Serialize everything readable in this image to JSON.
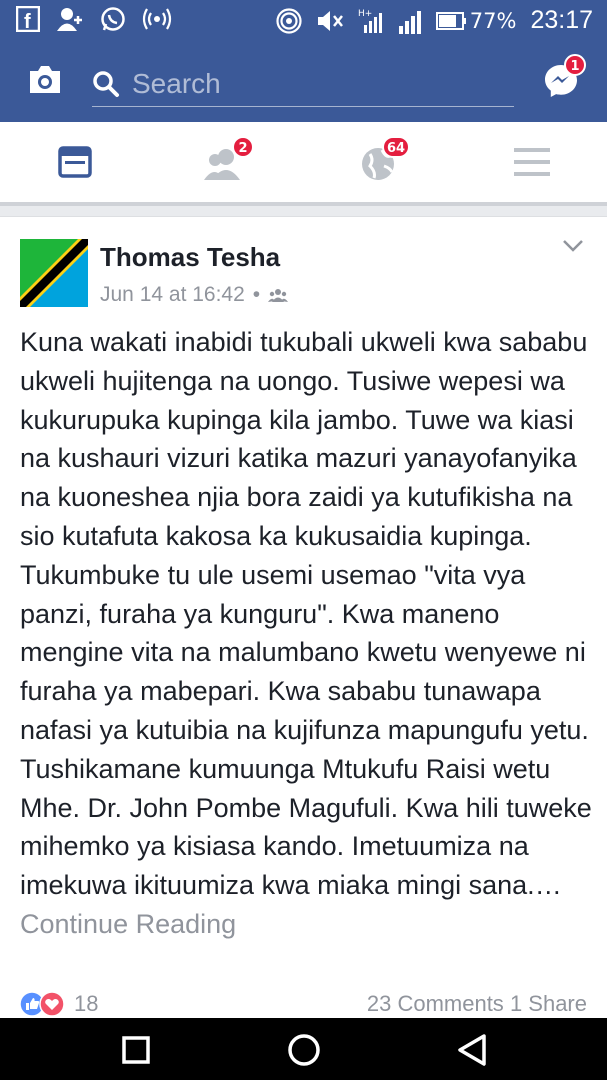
{
  "status_bar": {
    "battery": "77%",
    "time": "23:17"
  },
  "app_bar": {
    "search_placeholder": "Search",
    "messenger_badge": "1"
  },
  "tabs": [
    {
      "name": "news-feed",
      "badge": ""
    },
    {
      "name": "friend-requests",
      "badge": "2"
    },
    {
      "name": "notifications",
      "badge": "64"
    },
    {
      "name": "menu",
      "badge": ""
    }
  ],
  "post": {
    "author": "Thomas Tesha",
    "timestamp": "Jun 14 at 16:42",
    "separator": "•",
    "text": "Kuna  wakati inabidi tukubali ukweli kwa sababu ukweli hujitenga na uongo. Tusiwe wepesi wa kukurupuka kupinga kila jambo. Tuwe wa kiasi na kushauri vizuri katika mazuri yanayofanyika na kuoneshea njia bora zaidi ya kutufikisha na sio kutafuta kakosa ka kukusaidia kupinga. Tukumbuke tu ule usemi usemao \"vita vya panzi, furaha ya kunguru\". Kwa maneno mengine vita na malumbano kwetu wenyewe ni furaha ya mabepari. Kwa sababu tunawapa nafasi ya kutuibia na kujifunza mapungufu yetu. Tushikamane kumuunga Mtukufu Raisi wetu Mhe. Dr. John Pombe Magufuli. Kwa hili tuweke mihemko ya kisiasa  kando. Imetuumiza na imekuwa ikituumiza kwa miaka mingi sana.…",
    "continue_reading": "Continue Reading",
    "reaction_count": "18",
    "comments": "23 Comments",
    "shares": "1 Share"
  }
}
